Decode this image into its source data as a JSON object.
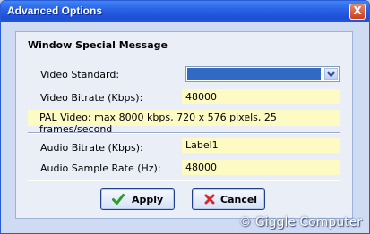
{
  "window": {
    "title": "Advanced Options",
    "close_glyph": "X"
  },
  "panel": {
    "heading": "Window Special Message",
    "video_standard": {
      "label": "Video Standard:",
      "value": ""
    },
    "video_bitrate": {
      "label": "Video Bitrate (Kbps):",
      "value": "48000"
    },
    "note": "PAL Video: max 8000 kbps, 720 x 576 pixels, 25 frames/second",
    "audio_bitrate": {
      "label": "Audio Bitrate (Kbps):",
      "value": "Label1"
    },
    "audio_sample_rate": {
      "label": "Audio Sample Rate (Hz):",
      "value": "48000"
    }
  },
  "buttons": {
    "apply": "Apply",
    "cancel": "Cancel"
  },
  "watermark": "© Giggle Computer",
  "colors": {
    "title_bar": "#2a62e5",
    "field_background": "#fdfbc3",
    "selection": "#316ac5",
    "apply_icon": "#2e9a2e",
    "cancel_icon": "#d62a2a"
  },
  "icons": {
    "apply": "checkmark-icon",
    "cancel": "x-icon",
    "dropdown": "chevron-down-icon"
  }
}
